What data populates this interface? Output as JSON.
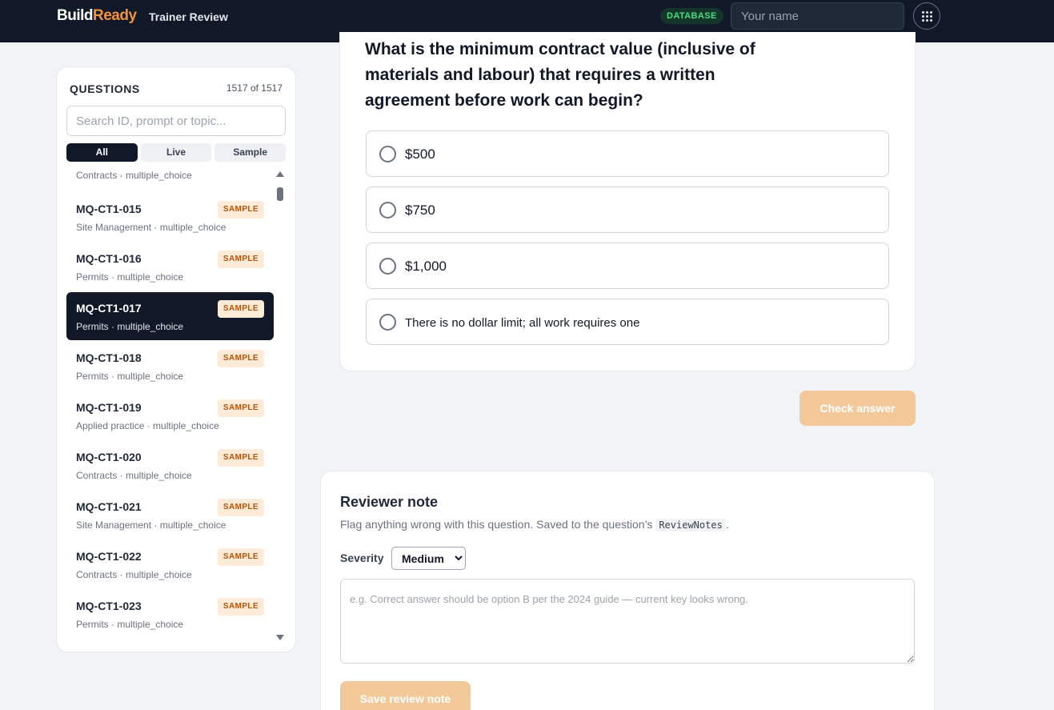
{
  "header": {
    "brand_part1": "Build",
    "brand_part2": "Ready",
    "subtitle": "Trainer Review",
    "db_badge": "DATABASE",
    "name_placeholder": "Your name"
  },
  "sidebar": {
    "heading": "QUESTIONS",
    "count": "1517 of 1517",
    "search_placeholder": "Search ID, prompt or topic...",
    "filters": [
      "All",
      "Live",
      "Sample"
    ],
    "active_filter": "All",
    "partial_item_meta": "Contracts · multiple_choice",
    "items": [
      {
        "id": "MQ-CT1-015",
        "meta": "Site Management · multiple_choice",
        "tag": "SAMPLE"
      },
      {
        "id": "MQ-CT1-016",
        "meta": "Permits · multiple_choice",
        "tag": "SAMPLE"
      },
      {
        "id": "MQ-CT1-017",
        "meta": "Permits · multiple_choice",
        "tag": "SAMPLE",
        "selected": true
      },
      {
        "id": "MQ-CT1-018",
        "meta": "Permits · multiple_choice",
        "tag": "SAMPLE"
      },
      {
        "id": "MQ-CT1-019",
        "meta": "Applied practice · multiple_choice",
        "tag": "SAMPLE"
      },
      {
        "id": "MQ-CT1-020",
        "meta": "Contracts · multiple_choice",
        "tag": "SAMPLE"
      },
      {
        "id": "MQ-CT1-021",
        "meta": "Site Management · multiple_choice",
        "tag": "SAMPLE"
      },
      {
        "id": "MQ-CT1-022",
        "meta": "Contracts · multiple_choice",
        "tag": "SAMPLE"
      },
      {
        "id": "MQ-CT1-023",
        "meta": "Permits · multiple_choice",
        "tag": "SAMPLE"
      }
    ]
  },
  "question": {
    "text": "What is the minimum contract value (inclusive of materials and labour) that requires a written agreement before work can begin?",
    "options": [
      "$500",
      "$750",
      "$1,000",
      "There is no dollar limit; all work requires one"
    ],
    "check_label": "Check answer"
  },
  "review": {
    "title": "Reviewer note",
    "desc_before": "Flag anything wrong with this question. Saved to the question’s ",
    "desc_code": "ReviewNotes",
    "desc_after": ".",
    "severity_label": "Severity",
    "severity_value": "Medium",
    "note_placeholder": "e.g. Correct answer should be option B per the 2024 guide — current key looks wrong.",
    "save_label": "Save review note"
  }
}
